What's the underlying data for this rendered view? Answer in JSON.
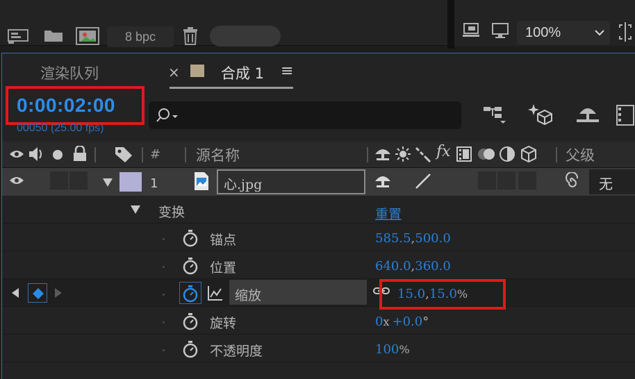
{
  "toolbar": {
    "bpc": "8 bpc",
    "zoom": "100%"
  },
  "tabs": [
    {
      "label": "渲染队列"
    },
    {
      "label": "合成 1",
      "close": "×",
      "menu": "≡"
    }
  ],
  "time": {
    "timecode": "0:00:02:00",
    "frames": "00050 (25.00 fps)"
  },
  "header": {
    "hash": "#",
    "source_name": "源名称",
    "parent": "父级"
  },
  "layer": {
    "index": "1",
    "name": "心.jpg",
    "parent_value": "无",
    "label_color": "#b3b0d8"
  },
  "transform": {
    "label": "变换",
    "reset": "重置",
    "props": [
      {
        "label": "锚点",
        "value_a": "585.5",
        "sep": ",",
        "value_b": "500.0",
        "suffix": ""
      },
      {
        "label": "位置",
        "value_a": "640.0",
        "sep": ",",
        "value_b": "360.0",
        "suffix": ""
      },
      {
        "label": "缩放",
        "value_a": "15.0",
        "sep": ",",
        "value_b": "15.0",
        "suffix": "%"
      },
      {
        "label": "旋转",
        "value_a": "0",
        "sep": "x",
        "value_b": "+0.0",
        "suffix": "°"
      },
      {
        "label": "不透明度",
        "value_a": "100",
        "sep": "",
        "value_b": "",
        "suffix": "%"
      }
    ]
  },
  "colors": {
    "accent": "#2d8ceb",
    "highlight": "#e0191c",
    "keyframe": "#2a8be6"
  }
}
